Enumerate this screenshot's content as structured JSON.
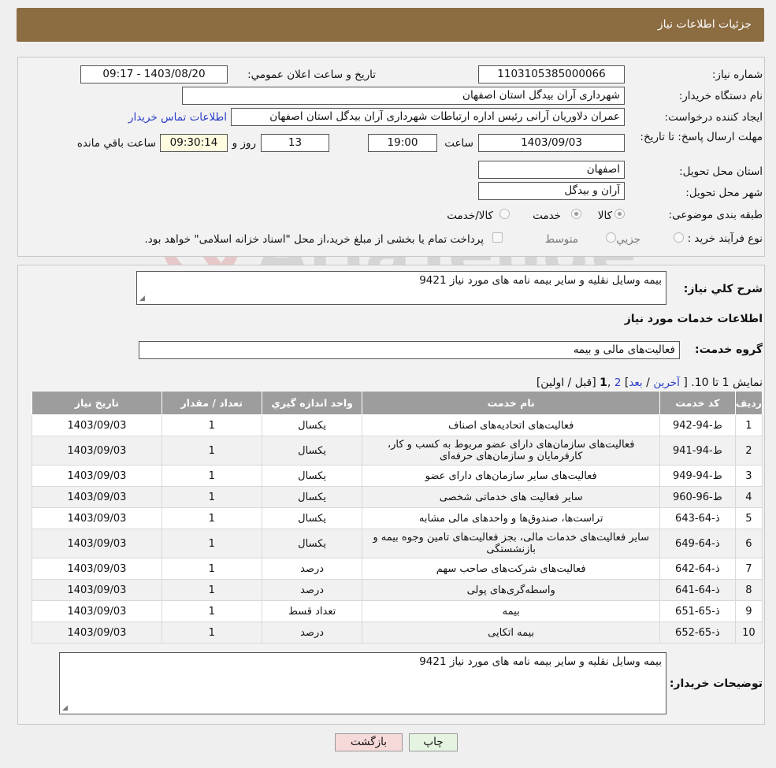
{
  "header": {
    "title": "جزئیات اطلاعات نیاز"
  },
  "need": {
    "number_label": "شماره نیاز:",
    "number": "1103105385000066",
    "announce_label": "تاریخ و ساعت اعلان عمومي:",
    "announce_value": "1403/08/20 - 09:17",
    "buyer_label": "نام دستگاه خريدار:",
    "buyer": "شهرداری آران بیدگل استان اصفهان",
    "creator_label": "ايجاد کننده درخواست:",
    "creator": "عمران دلاوریان آرانی رئیس اداره ارتباطات شهرداری آران بیدگل استان اصفهان",
    "contact_link": "اطلاعات تماس خریدار",
    "deadline_label": "مهلت ارسال پاسخ: تا تاريخ:",
    "deadline_date": "1403/09/03",
    "time_label": "ساعت",
    "deadline_time": "19:00",
    "days": "13",
    "days_label": "روز و",
    "remaining": "09:30:14",
    "remaining_label": "ساعت باقي مانده",
    "province_label": "استان محل تحويل:",
    "province": "اصفهان",
    "city_label": "شهر محل تحويل:",
    "city": "آران و بیدگل",
    "category_label": "طبقه بندی موضوعی:",
    "category_options": [
      "کالا",
      "خدمت",
      "کالا/خدمت"
    ],
    "process_label": "نوع فرآيند خريد :",
    "process_options": [
      "جزيي",
      "متوسط"
    ],
    "process_note": "پرداخت تمام يا بخشی از مبلغ خريد،از محل \"اسناد خزانه اسلامی\" خواهد بود."
  },
  "summary": {
    "label": "شرح کلي نياز:",
    "value": "بیمه وسایل نقلیه و سایر بیمه نامه های مورد نیاز 9421",
    "services_title": "اطلاعات خدمات مورد نياز",
    "group_label": "گروه خدمت:",
    "group_value": "فعالیت‌های مالی و بیمه"
  },
  "pagination": {
    "show": "نمایش 1 تا 10.",
    "open": "[",
    "last": "آخرین",
    "sep1": "/",
    "next": "بعد",
    "close1": "]",
    "page2": "2",
    "comma": ",",
    "page1": "1",
    "prev_first": "[قبل / اولین]"
  },
  "table": {
    "headers": [
      "رديف",
      "کد خدمت",
      "نام خدمت",
      "واحد اندازه گيري",
      "تعداد / مقدار",
      "تاريخ نياز"
    ],
    "rows": [
      [
        "1",
        "ط-94-942",
        "فعالیت‌های اتحادیه‌های اصناف",
        "یکسال",
        "1",
        "1403/09/03"
      ],
      [
        "2",
        "ط-94-941",
        "فعالیت‌های سازمان‌های دارای عضو مربوط به کسب و کار، کارفرمایان و سازمان‌های حرفه‌ای",
        "یکسال",
        "1",
        "1403/09/03"
      ],
      [
        "3",
        "ط-94-949",
        "فعالیت‌های سایر سازمان‌های دارای عضو",
        "یکسال",
        "1",
        "1403/09/03"
      ],
      [
        "4",
        "ط-96-960",
        "سایر فعالیت های خدماتی شخصی",
        "یکسال",
        "1",
        "1403/09/03"
      ],
      [
        "5",
        "ذ-64-643",
        "تراست‌ها، صندوق‌ها و واحدهای مالی مشابه",
        "یکسال",
        "1",
        "1403/09/03"
      ],
      [
        "6",
        "ذ-64-649",
        "سایر فعالیت‌های خدمات مالی، بجز فعالیت‌های تامین وجوه بیمه و بازنشستگی",
        "یکسال",
        "1",
        "1403/09/03"
      ],
      [
        "7",
        "ذ-64-642",
        "فعالیت‌های شرکت‌های صاحب سهم",
        "درصد",
        "1",
        "1403/09/03"
      ],
      [
        "8",
        "ذ-64-641",
        "واسطه‌گری‌های پولی",
        "درصد",
        "1",
        "1403/09/03"
      ],
      [
        "9",
        "ذ-65-651",
        "بیمه",
        "تعداد قسط",
        "1",
        "1403/09/03"
      ],
      [
        "10",
        "ذ-65-652",
        "بیمه اتکایی",
        "درصد",
        "1",
        "1403/09/03"
      ]
    ]
  },
  "buyer_notes": {
    "label": "توضيحات خريدار:",
    "value": "بیمه وسایل نقلیه و سایر بیمه نامه های مورد نیاز 9421"
  },
  "buttons": {
    "print": "چاپ",
    "back": "بازگشت"
  },
  "watermark": {
    "text": "AriaTender.neT"
  }
}
